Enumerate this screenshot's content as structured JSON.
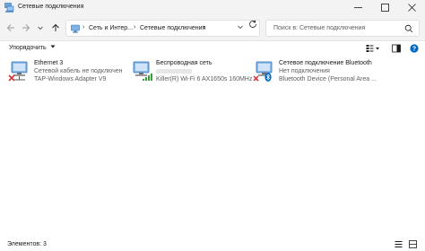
{
  "window": {
    "title": "Сетевые подключения",
    "icon": "network-connections-icon"
  },
  "address": {
    "breadcrumb": [
      "Сеть и Интер...",
      "Сетевые подключения"
    ],
    "search_placeholder": "Поиск в: Сетевые подключения"
  },
  "toolbar": {
    "organize_label": "Упорядочить"
  },
  "connections": [
    {
      "name": "Ethernet 3",
      "status": "Сетевой кабель не подключен",
      "device": "TAP-Windows Adapter V9",
      "icon": "ethernet-icon",
      "overlay": "red-x"
    },
    {
      "name": "Беспроводная сеть",
      "status": "",
      "device": "Killer(R) Wi-Fi 6 AX1650s 160MHz ...",
      "icon": "wireless-icon",
      "overlay": "signal-bars"
    },
    {
      "name": "Сетевое подключение Bluetooth",
      "status": "Нет подключения",
      "device": "Bluetooth Device (Personal Area ...",
      "icon": "bluetooth-icon",
      "overlay": "red-x"
    }
  ],
  "status_bar": {
    "items_label": "Элементов: 3"
  },
  "colors": {
    "chrome": "#f3f3f3",
    "accent": "#0067c0",
    "error": "#d13438",
    "signal": "#3a9d3a"
  }
}
